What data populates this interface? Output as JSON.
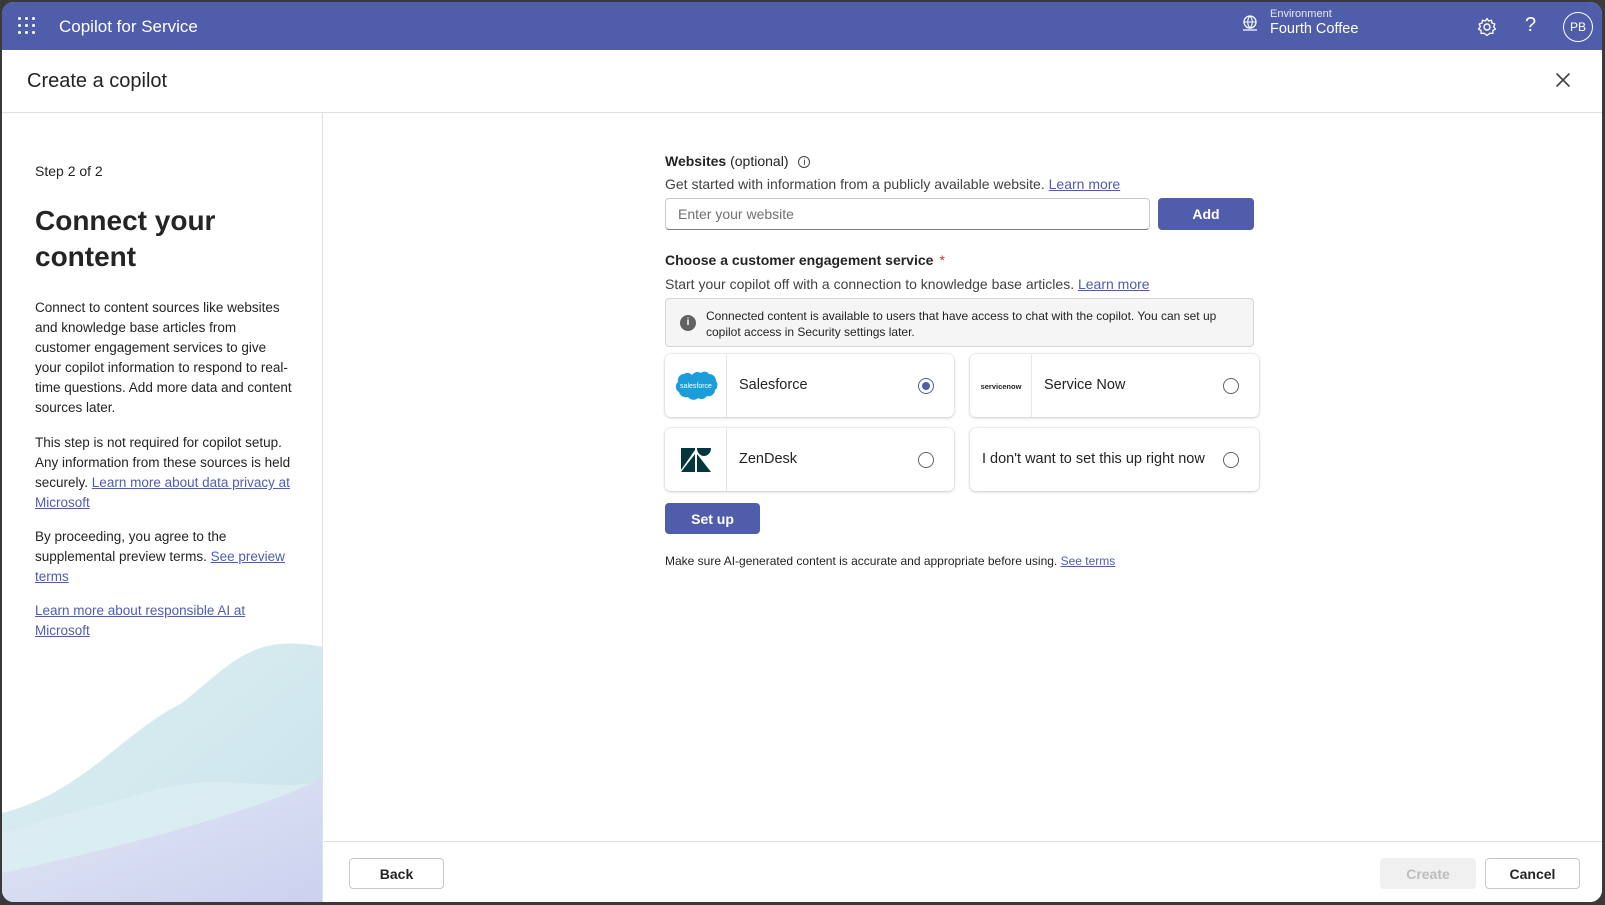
{
  "header": {
    "app_title": "Copilot for Service",
    "environment_label": "Environment",
    "environment_name": "Fourth Coffee",
    "help_glyph": "?",
    "avatar_initials": "PB",
    "accent": "#4f5dab"
  },
  "dialog": {
    "title": "Create a copilot"
  },
  "left_panel": {
    "step": "Step 2 of 2",
    "heading": "Connect your content",
    "intro": "Connect to content sources like websites and knowledge base articles from customer engagement services to give your copilot information to respond to real-time questions. Add more data and content sources later.",
    "privacy_text": "This step is not required for copilot setup. Any information from these sources is held securely.",
    "privacy_link": "Learn more about data privacy at Microsoft",
    "terms_text": "By proceeding, you agree to the supplemental preview terms.",
    "terms_link": "See preview terms",
    "responsible_ai_link": "Learn more about responsible AI at Microsoft"
  },
  "websites": {
    "label": "Websites",
    "optional": "(optional)",
    "info_glyph": "i",
    "description": "Get started with information from a publicly available website.",
    "learn_more": "Learn more",
    "placeholder": "Enter your website",
    "value": "",
    "add_label": "Add"
  },
  "engagement": {
    "label": "Choose a customer engagement service",
    "required_mark": "*",
    "description": "Start your copilot off with a connection to knowledge base articles.",
    "learn_more": "Learn more",
    "info_glyph": "i",
    "info_text": "Connected content is available to users that have access to chat with the copilot. You can set up copilot access in Security settings later.",
    "options": [
      {
        "name": "Salesforce",
        "logo": "salesforce-logo",
        "logo_text": "salesforce",
        "selected": true
      },
      {
        "name": "Service Now",
        "logo": "servicenow-logo",
        "logo_text": "servicenow",
        "selected": false
      },
      {
        "name": "ZenDesk",
        "logo": "zendesk-logo",
        "selected": false
      },
      {
        "name": "I don't want to set this up right now",
        "logo": "",
        "selected": false
      }
    ],
    "setup_label": "Set up"
  },
  "disclaimer": {
    "text": "Make sure AI-generated content is accurate and appropriate before using.",
    "link": "See terms"
  },
  "footer": {
    "back_label": "Back",
    "create_label": "Create",
    "cancel_label": "Cancel"
  }
}
